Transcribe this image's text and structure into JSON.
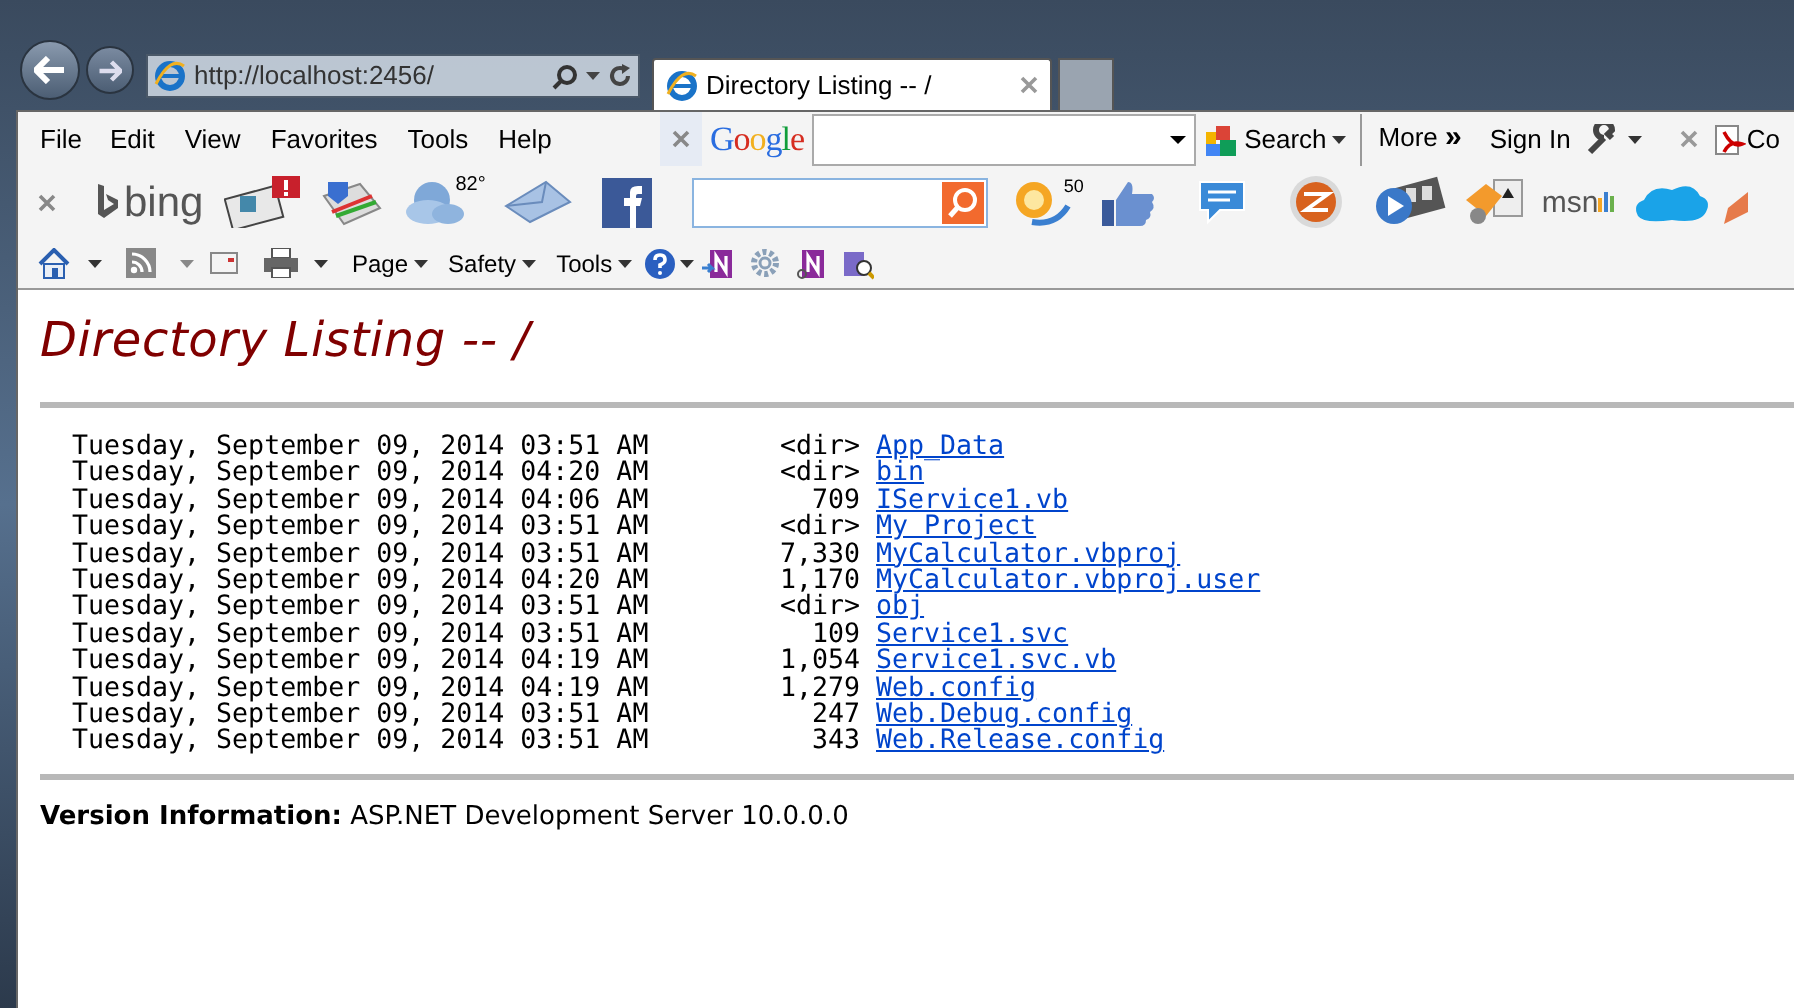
{
  "browser": {
    "address": "http://localhost:2456/",
    "tab_title": "Directory Listing -- /"
  },
  "menu_bar": [
    "File",
    "Edit",
    "View",
    "Favorites",
    "Tools",
    "Help"
  ],
  "google_toolbar": {
    "logo": "Google",
    "search": "Search",
    "more": "More",
    "more_glyph": "»",
    "sign_in": "Sign In",
    "cut_label": "Co"
  },
  "bing_toolbar": {
    "logo": "bing",
    "weather_temp": "82°",
    "badge_count": "50",
    "msn_label": "msn"
  },
  "command_bar": [
    "Page",
    "Safety",
    "Tools"
  ],
  "page": {
    "title": "Directory Listing -- /",
    "entries": [
      {
        "date": "Tuesday, September 09, 2014 03:51 AM",
        "size": "<dir>",
        "name": "App_Data"
      },
      {
        "date": "Tuesday, September 09, 2014 04:20 AM",
        "size": "<dir>",
        "name": "bin"
      },
      {
        "date": "Tuesday, September 09, 2014 04:06 AM",
        "size": "709",
        "name": "IService1.vb"
      },
      {
        "date": "Tuesday, September 09, 2014 03:51 AM",
        "size": "<dir>",
        "name": "My Project"
      },
      {
        "date": "Tuesday, September 09, 2014 03:51 AM",
        "size": "7,330",
        "name": "MyCalculator.vbproj"
      },
      {
        "date": "Tuesday, September 09, 2014 04:20 AM",
        "size": "1,170",
        "name": "MyCalculator.vbproj.user"
      },
      {
        "date": "Tuesday, September 09, 2014 03:51 AM",
        "size": "<dir>",
        "name": "obj"
      },
      {
        "date": "Tuesday, September 09, 2014 03:51 AM",
        "size": "109",
        "name": "Service1.svc"
      },
      {
        "date": "Tuesday, September 09, 2014 04:19 AM",
        "size": "1,054",
        "name": "Service1.svc.vb"
      },
      {
        "date": "Tuesday, September 09, 2014 04:19 AM",
        "size": "1,279",
        "name": "Web.config"
      },
      {
        "date": "Tuesday, September 09, 2014 03:51 AM",
        "size": "247",
        "name": "Web.Debug.config"
      },
      {
        "date": "Tuesday, September 09, 2014 03:51 AM",
        "size": "343",
        "name": "Web.Release.config"
      }
    ],
    "version_info": "**Version Information:** ASP.NET Development Server 10.0.0.0"
  }
}
